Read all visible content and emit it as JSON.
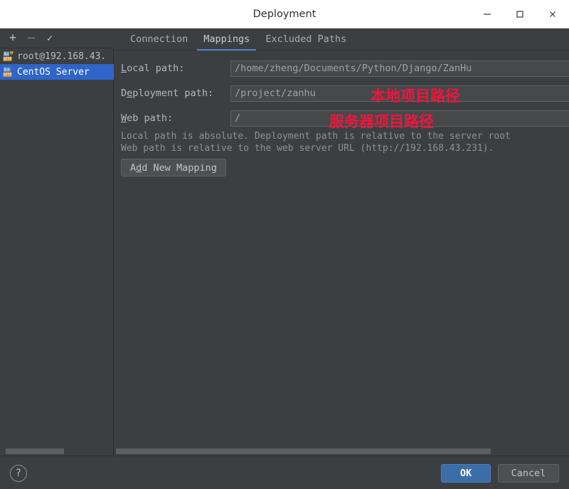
{
  "window": {
    "title": "Deployment",
    "controls": [
      {
        "name": "minimize",
        "glyph": "—"
      },
      {
        "name": "maximize",
        "glyph": "□"
      },
      {
        "name": "close",
        "glyph": "✕"
      }
    ]
  },
  "sidebar": {
    "toolbar": [
      {
        "name": "add-server-button",
        "label": "+"
      },
      {
        "name": "remove-server-button",
        "label": "–"
      },
      {
        "name": "apply-server-button",
        "label": "✓"
      }
    ],
    "servers": [
      {
        "label": "root@192.168.43.",
        "icon": "sftp-server-icon",
        "selected": false
      },
      {
        "label": "CentOS Server",
        "icon": "sftp-server-icon",
        "selected": true
      }
    ]
  },
  "main": {
    "tabs": [
      {
        "label": "Connection",
        "active": false
      },
      {
        "label": "Mappings",
        "active": true
      },
      {
        "label": "Excluded Paths",
        "active": false
      }
    ],
    "fields": {
      "local_path": {
        "label_pre": "L",
        "label_mnemonic": "",
        "label": "ocal path:",
        "value": "/home/zheng/Documents/Python/Django/ZanHu"
      },
      "deployment_path": {
        "label_pre": "D",
        "label_mnemonic": "e",
        "label": "ployment path:",
        "value": "/project/zanhu"
      },
      "web_path": {
        "label_pre": "",
        "label_mnemonic": "W",
        "label": "eb path:",
        "value": "/"
      }
    },
    "hint_line1": "Local path is absolute. Deployment path is relative to the server root",
    "hint_line2": "Web path is relative to the web server URL (http://192.168.43.231).",
    "add_mapping": {
      "pre": "A",
      "mnemonic": "d",
      "post": "d New Mapping"
    },
    "annotations": [
      {
        "name": "annotation-local-path",
        "text": "本地项目路径",
        "color": "#f2143c"
      },
      {
        "name": "annotation-deployment-path",
        "text": "服务器项目路径",
        "color": "#f2143c"
      }
    ]
  },
  "footer": {
    "help_label": "?",
    "ok_label": "OK",
    "cancel_label": "Cancel"
  },
  "colors": {
    "background": "#3c3f41",
    "titlebar": "#ffffff",
    "selection": "#2f65c8",
    "accent": "#4a88c7",
    "ok_button": "#3b6ea8",
    "annotation": "#f2143c"
  }
}
